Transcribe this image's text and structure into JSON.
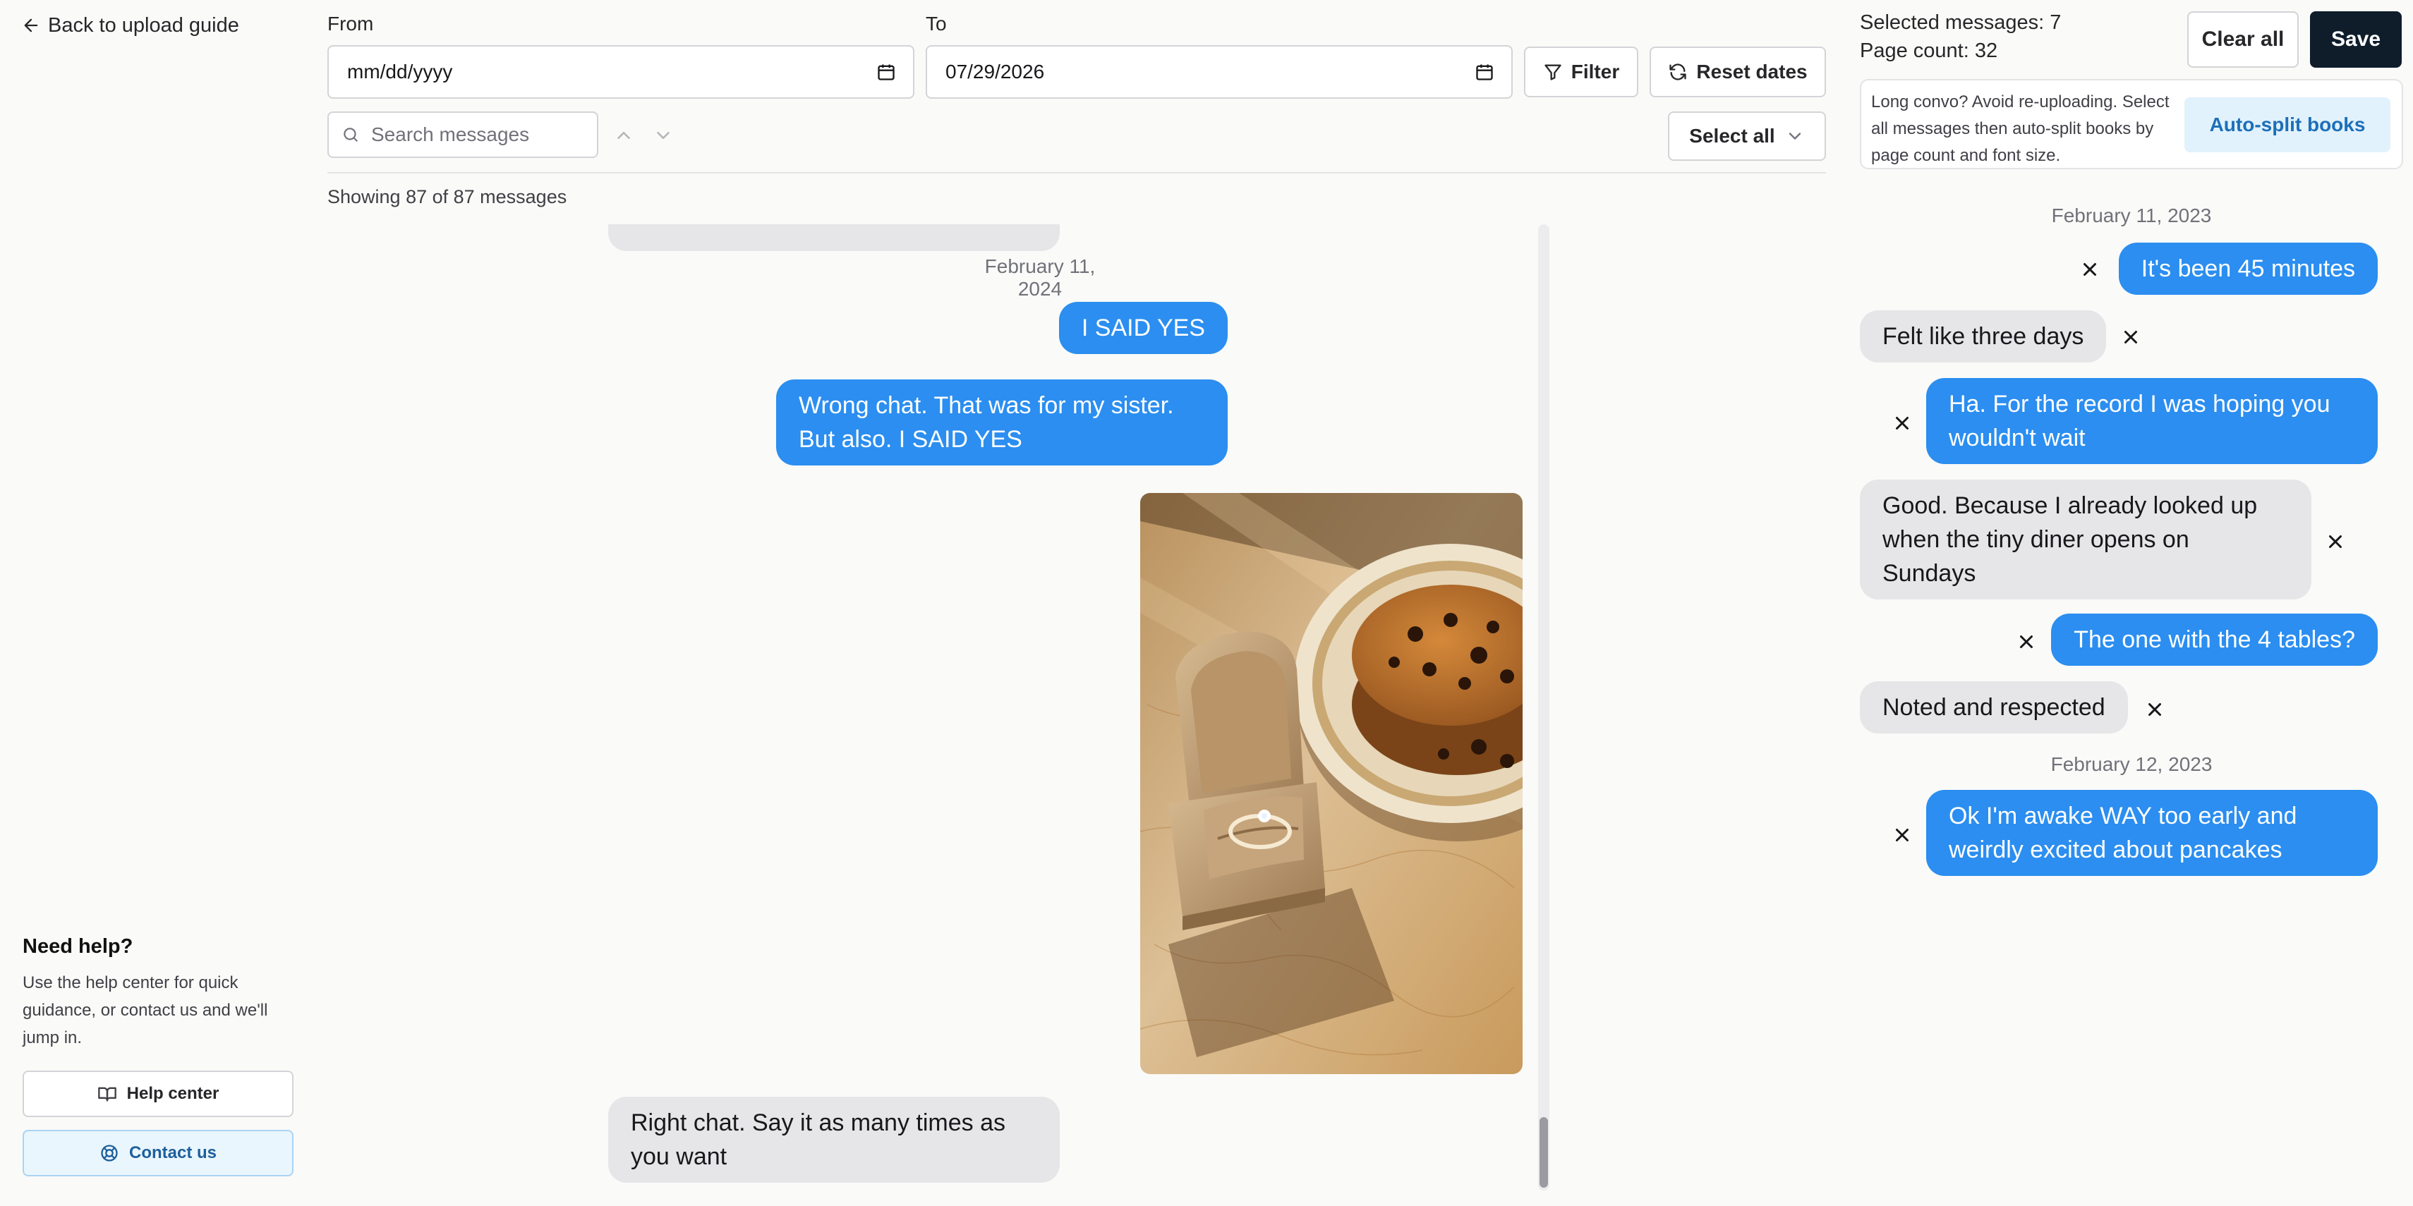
{
  "sidebar": {
    "back_label": "Back to upload guide",
    "help_title": "Need help?",
    "help_text": "Use the help center for quick guidance, or contact us and we'll jump in.",
    "help_center_label": "Help center",
    "contact_label": "Contact us"
  },
  "filters": {
    "from_label": "From",
    "from_value": "mm/dd/yyyy",
    "to_label": "To",
    "to_value": "07/29/2026",
    "filter_label": "Filter",
    "reset_label": "Reset dates",
    "search_placeholder": "Search messages",
    "select_all_label": "Select all",
    "showing_text": "Showing 87 of 87 messages"
  },
  "chat": {
    "date_header": "February 11, 2024",
    "messages": [
      {
        "direction": "out",
        "text": "I SAID YES"
      },
      {
        "direction": "out",
        "text": "Wrong chat. That was for my sister. But also. I SAID YES"
      },
      {
        "direction": "out",
        "type": "image",
        "text": ""
      },
      {
        "direction": "in",
        "text": "Right chat. Say it as many times as you want"
      }
    ]
  },
  "selection": {
    "selected_text": "Selected messages: 7",
    "page_count_text": "Page count: 32",
    "clear_label": "Clear all",
    "save_label": "Save",
    "tip_text": "Long convo? Avoid re-uploading. Select all messages then auto-split books by page count and font size.",
    "autosplit_label": "Auto-split books",
    "groups": [
      {
        "date": "February 11, 2023",
        "messages": [
          {
            "direction": "out",
            "text": "It's been 45 minutes"
          },
          {
            "direction": "in",
            "text": "Felt like three days"
          },
          {
            "direction": "out",
            "text": "Ha. For the record I was hoping you wouldn't wait"
          },
          {
            "direction": "in",
            "text": "Good. Because I already looked up when the tiny diner opens on Sundays"
          },
          {
            "direction": "out",
            "text": "The one with the 4 tables?"
          },
          {
            "direction": "in",
            "text": "Noted and respected"
          }
        ]
      },
      {
        "date": "February 12, 2023",
        "messages": [
          {
            "direction": "out",
            "text": "Ok I'm awake WAY too early and weirdly excited about pancakes"
          }
        ]
      }
    ]
  },
  "colors": {
    "outgoing_bubble": "#2b8ef0",
    "incoming_bubble": "#e6e6e9",
    "save_button": "#0f1d2b",
    "accent_light": "#e1f2fd"
  },
  "icons": [
    "arrow-left-icon",
    "calendar-icon",
    "filter-icon",
    "refresh-icon",
    "search-icon",
    "chevron-up-icon",
    "chevron-down-icon",
    "close-icon",
    "book-icon",
    "lifebuoy-icon"
  ]
}
